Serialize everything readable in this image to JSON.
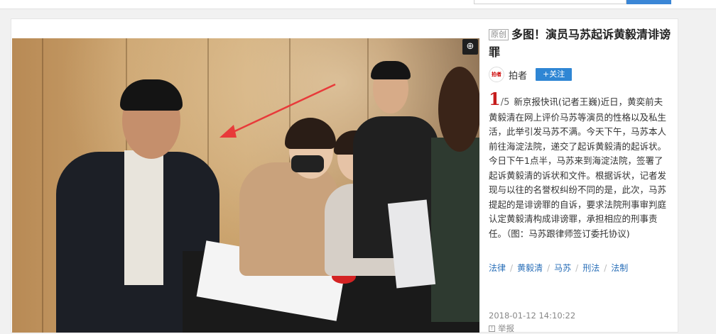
{
  "article": {
    "original_tag": "原创",
    "title": "多图！演员马苏起诉黄毅清诽谤罪",
    "author": {
      "logo_text": "拍者",
      "name": "拍者",
      "follow_label": "+关注"
    },
    "photo": {
      "current": "1",
      "total": "/5",
      "caption": "新京报快讯(记者王巍)近日，黄奕前夫黄毅清在网上评价马苏等演员的性格以及私生活，此举引发马苏不满。今天下午，马苏本人前往海淀法院，递交了起诉黄毅清的起诉状。今日下午1点半，马苏来到海淀法院，签署了起诉黄毅清的诉状和文件。根据诉状，记者发现与以往的名誉权纠纷不同的是，此次，马苏提起的是诽谤罪的自诉，要求法院刑事审判庭认定黄毅清构成诽谤罪，承担相应的刑事责任。（图：马苏跟律师签订委托协议)"
    },
    "tags": [
      "法律",
      "黄毅清",
      "马苏",
      "刑法",
      "法制"
    ],
    "tag_separator": "/",
    "timestamp": "2018-01-12 14:10:22",
    "report_label": "举报"
  },
  "icons": {
    "zoom": "zoom-in-icon",
    "report": "flag-icon"
  },
  "colors": {
    "accent": "#2f86d4",
    "page_number": "#c61d1d",
    "tag_link": "#2a6fb8"
  }
}
